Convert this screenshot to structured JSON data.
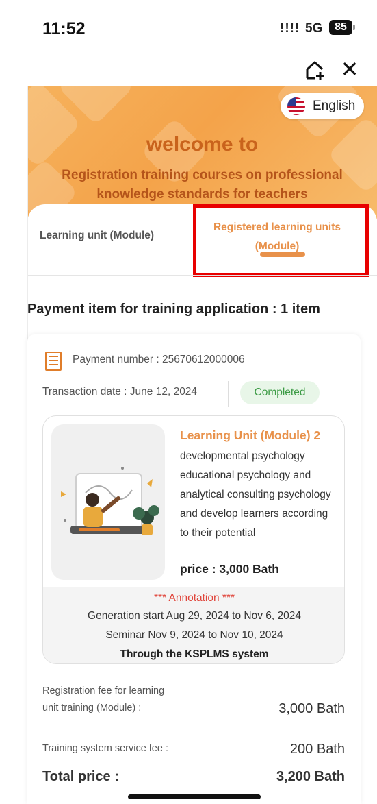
{
  "status_bar": {
    "time": "11:52",
    "signal": "!!!!",
    "network": "5G",
    "battery": "85"
  },
  "topbar": {
    "add_icon": "add-to-home-icon",
    "close_icon": "close-icon",
    "close_glyph": "✕"
  },
  "hero": {
    "language_label": "English",
    "flag_icon": "us-flag-icon",
    "welcome": "welcome to",
    "title": "Registration training courses on professional knowledge standards for teachers"
  },
  "tabs": [
    {
      "label": "Learning unit (Module)",
      "active": false
    },
    {
      "label": "Registered learning units (Module)",
      "active": true
    }
  ],
  "section_title": "Payment item for training application : 1 item",
  "payment": {
    "number_label": "Payment number : 25670612000006",
    "date_label": "Transaction date : June 12, 2024",
    "status": "Completed",
    "module": {
      "title": "Learning Unit (Module) 2",
      "description": "developmental psychology educational psychology and analytical consulting psychology and develop learners according to their potential",
      "price": "price : 3,000 Bath",
      "annotation_title": "*** Annotation ***",
      "generation": "Generation start Aug 29, 2024 to Nov 6, 2024",
      "seminar": "Seminar Nov 9, 2024 to Nov 10, 2024",
      "system": "Through the KSPLMS system"
    },
    "fee_label": "Registration fee for learning unit training (Module) :",
    "fee_value": "3,000 Bath",
    "service_label": "Training system service fee :",
    "service_value": "200 Bath",
    "total_label": "Total price :",
    "total_value": "3,200 Bath"
  },
  "colors": {
    "accent": "#e8914a",
    "hero": "#f4a34a",
    "success": "#3c9b45",
    "annotation": "#e0443a",
    "highlight": "#e80000"
  }
}
